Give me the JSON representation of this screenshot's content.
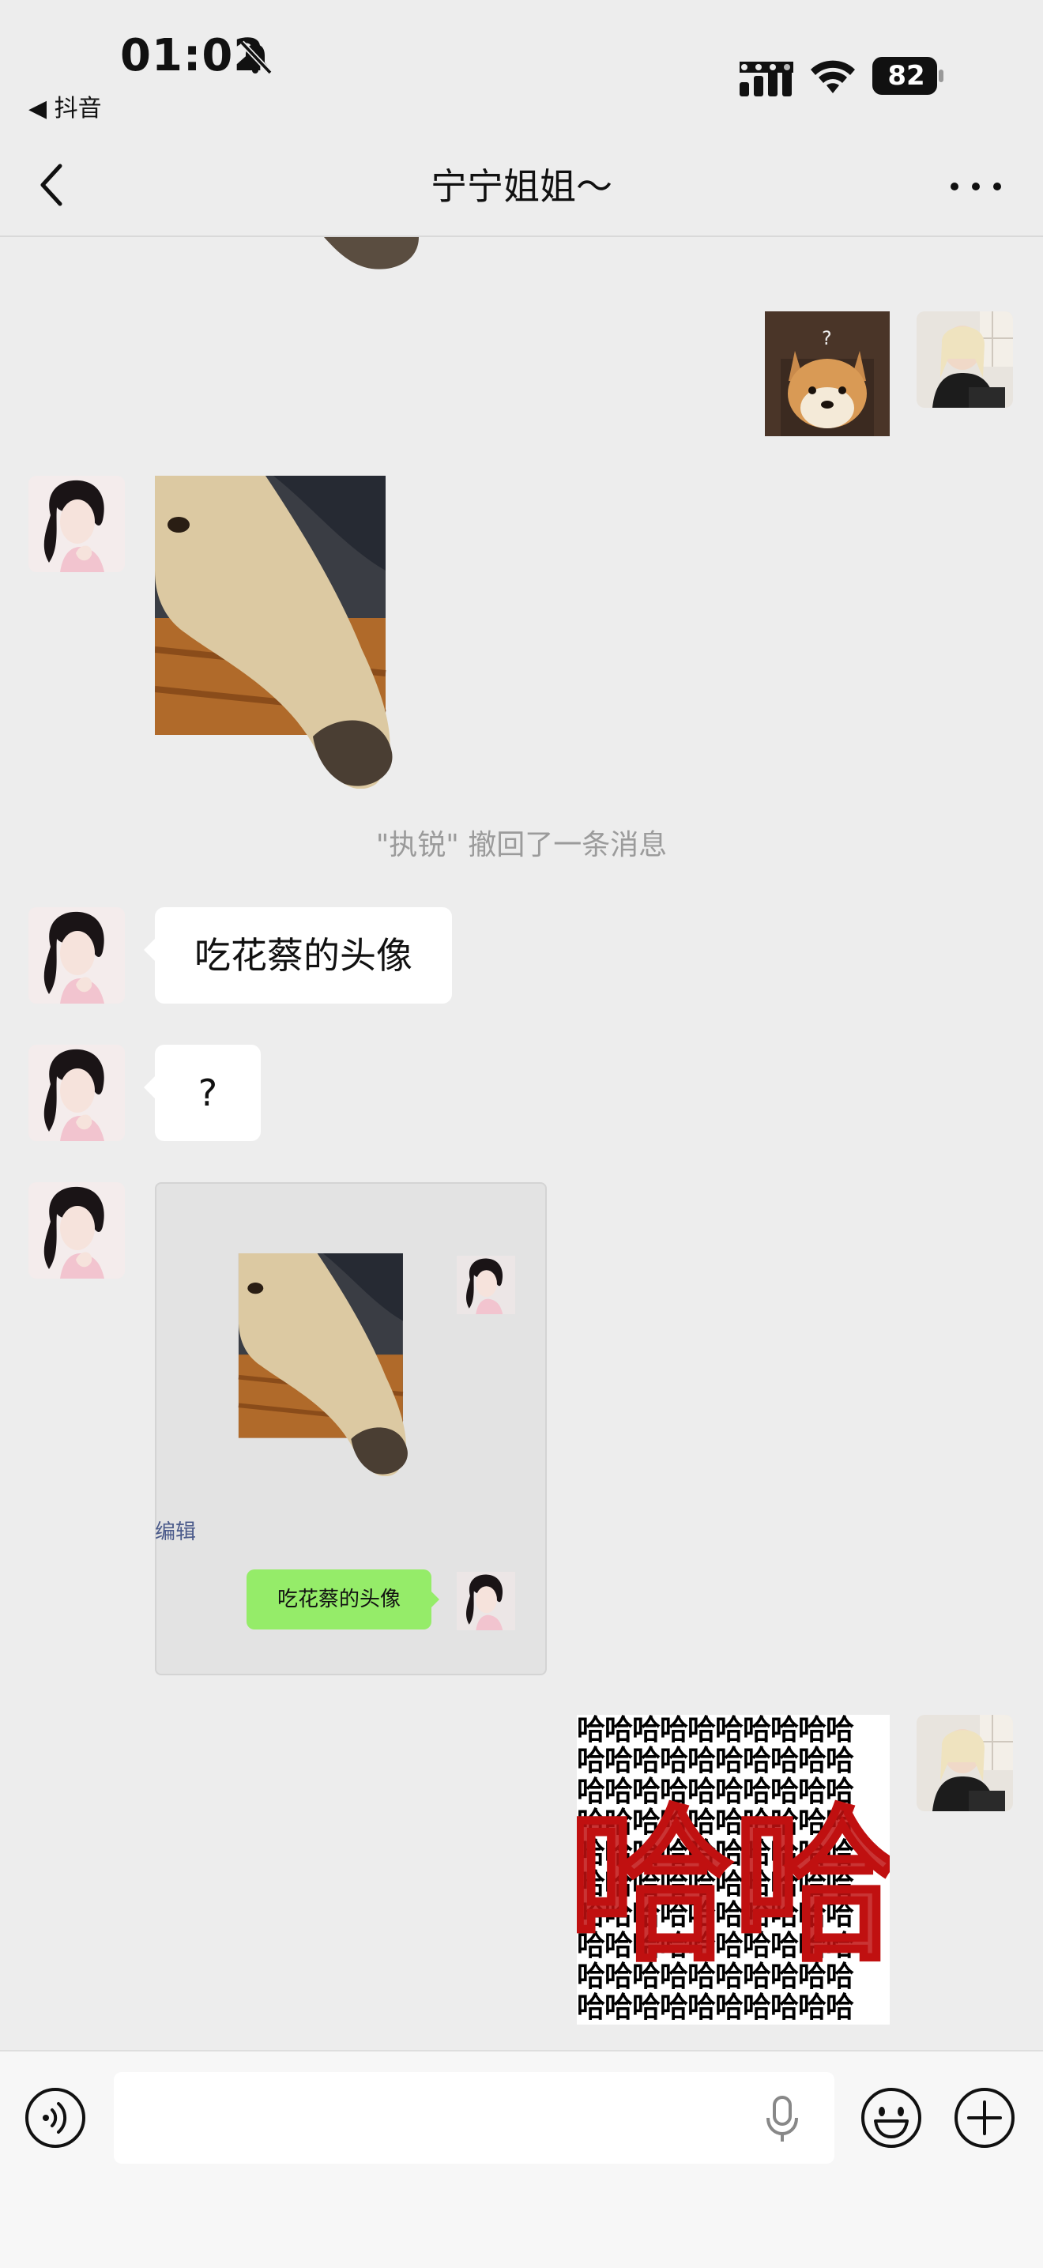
{
  "status_bar": {
    "time": "01:02",
    "back_app": "◀ 抖音",
    "battery": "82"
  },
  "nav": {
    "title": "宁宁姐姐～"
  },
  "messages": {
    "recall_notice": "\"执锐\" 撤回了一条消息",
    "text_1": "吃花蔡的头像",
    "text_2": "?",
    "quote": {
      "edit_label": "编辑",
      "bubble_text": "吃花蔡的头像"
    },
    "sticker_small_char": "哈",
    "sticker_big_text": "哈哈"
  },
  "colors": {
    "background": "#ededed",
    "bubble_green": "#95ec69",
    "sticker_red": "#c01010"
  }
}
